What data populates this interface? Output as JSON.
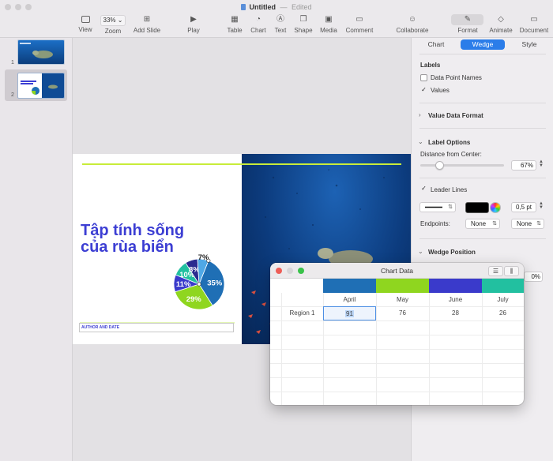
{
  "window": {
    "title": "Untitled",
    "subtitle": "Edited"
  },
  "toolbar": {
    "view": "View",
    "zoom_value": "33%",
    "zoom": "Zoom",
    "add_slide": "Add Slide",
    "play": "Play",
    "table": "Table",
    "chart": "Chart",
    "text": "Text",
    "shape": "Shape",
    "media": "Media",
    "comment": "Comment",
    "collaborate": "Collaborate",
    "format": "Format",
    "animate": "Animate",
    "document": "Document"
  },
  "navigator": {
    "slide1_num": "1",
    "slide2_num": "2"
  },
  "slide": {
    "title_line1": "Tập tính sống",
    "title_line2": "của rùa biển",
    "author": "AUTHOR AND DATE"
  },
  "chart_data": {
    "type": "pie",
    "slices": [
      {
        "label": "35%",
        "value": 35,
        "color": "#1f6fb5"
      },
      {
        "label": "29%",
        "value": 29,
        "color": "#8fd61f"
      },
      {
        "label": "11%",
        "value": 11,
        "color": "#3a3acb"
      },
      {
        "label": "10%",
        "value": 10,
        "color": "#22c0a0"
      },
      {
        "label": "8%",
        "value": 8,
        "color": "#2b2b8f"
      },
      {
        "label": "7%",
        "value": 7,
        "color": "#4fa8e6"
      }
    ]
  },
  "inspector": {
    "tabs": [
      "Chart",
      "Wedge",
      "Style"
    ],
    "active_tab": "Wedge",
    "labels_heading": "Labels",
    "data_point_names": "Data Point Names",
    "data_point_names_checked": false,
    "values": "Values",
    "values_checked": true,
    "value_data_format": "Value Data Format",
    "label_options": "Label Options",
    "distance_label": "Distance from Center:",
    "distance_value": "67%",
    "distance_fraction": 0.67,
    "leader_lines": "Leader Lines",
    "leader_lines_checked": true,
    "line_width": "0,5 pt",
    "line_color": "#000000",
    "endpoints_label": "Endpoints:",
    "endpoint_left": "None",
    "endpoint_right": "None",
    "wedge_position": "Wedge Position",
    "wedge_value": "0%"
  },
  "chart_window": {
    "title": "Chart Data",
    "columns": [
      "April",
      "May",
      "June",
      "July"
    ],
    "column_colors": [
      "#1f6fb5",
      "#8fd61f",
      "#3a3acb",
      "#22c0a0"
    ],
    "rows": [
      {
        "label": "Region 1",
        "values": [
          "91",
          "76",
          "28",
          "26"
        ]
      }
    ]
  }
}
